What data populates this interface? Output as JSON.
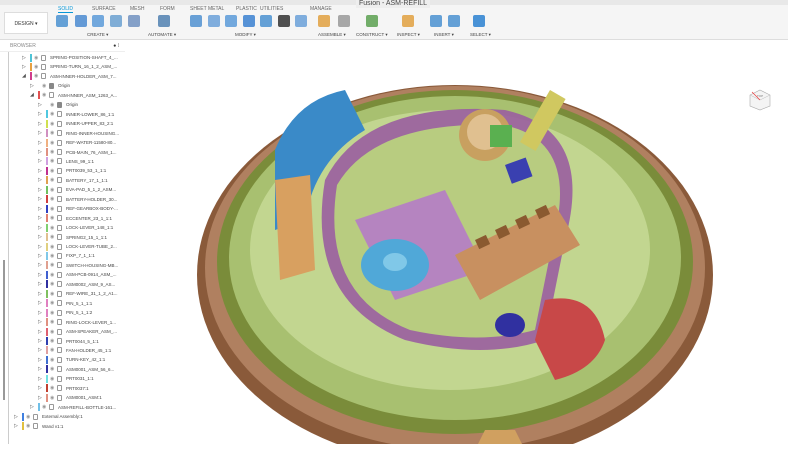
{
  "title": "Fusion - ASM-REFILL",
  "ribbon": {
    "design_label": "DESIGN ▾",
    "tabs": [
      "SOLID",
      "SURFACE",
      "MESH",
      "FORM",
      "SHEET METAL",
      "PLASTIC",
      "UTILITIES",
      "MANAGE"
    ],
    "active_tab": "SOLID",
    "groups": [
      "CREATE ▾",
      "AUTOMATE ▾",
      "MODIFY ▾",
      "ASSEMBLE ▾",
      "CONSTRUCT ▾",
      "INSPECT ▾",
      "INSERT ▾",
      "SELECT ▾"
    ]
  },
  "browser": {
    "title": "BROWSER",
    "items": [
      {
        "label": "SPRING-POSITION-SHAFT_4_...",
        "level": 1,
        "color": "#4ec3d6",
        "type": "body"
      },
      {
        "label": "SPRING-TURN_16_1_2_ASM_...",
        "level": 1,
        "color": "#e8a040",
        "type": "asm"
      },
      {
        "label": "ASM-INNER-HOLDER_ASM_7...",
        "level": 1,
        "color": "#d03c8c",
        "type": "asm",
        "expanded": true
      },
      {
        "label": "Origin",
        "level": 2,
        "color": "",
        "type": "folder"
      },
      {
        "label": "ASM-INNER_ASM_1263_A...",
        "level": 2,
        "color": "#e05050",
        "type": "asm",
        "expanded": true
      },
      {
        "label": "Origin",
        "level": 3,
        "color": "",
        "type": "folder"
      },
      {
        "label": "INNER-LOWER_86_1:1",
        "level": 3,
        "color": "#50c8e0",
        "type": "body"
      },
      {
        "label": "INNER-UPPER_83_2:1",
        "level": 3,
        "color": "#d0e050",
        "type": "body"
      },
      {
        "label": "RING-INNER-HOUSING...",
        "level": 3,
        "color": "#d090c0",
        "type": "body"
      },
      {
        "label": "REF-WATER-11580-80...",
        "level": 3,
        "color": "#f0b080",
        "type": "body"
      },
      {
        "label": "PCB-MAIN_76_ASM_1...",
        "level": 3,
        "color": "#e09080",
        "type": "asm"
      },
      {
        "label": "LENS_99_1:1",
        "level": 3,
        "color": "#d0a0e0",
        "type": "body"
      },
      {
        "label": "PRT0039_53_1_1:1",
        "level": 3,
        "color": "#c03090",
        "type": "body"
      },
      {
        "label": "BATTERY_17_1_1:1",
        "level": 3,
        "color": "#e0a050",
        "type": "body"
      },
      {
        "label": "EVA-PAD_5_1_2_ASM...",
        "level": 3,
        "color": "#70c060",
        "type": "asm"
      },
      {
        "label": "BATTERY-HOLDER_30...",
        "level": 3,
        "color": "#d04040",
        "type": "body"
      },
      {
        "label": "REF-GEARBOX-BODY-...",
        "level": 3,
        "color": "#3040c0",
        "type": "body"
      },
      {
        "label": "ECCENTER_23_1_1:1",
        "level": 3,
        "color": "#e08070",
        "type": "body"
      },
      {
        "label": "LOCK-LEVER_148_1:1",
        "level": 3,
        "color": "#80d070",
        "type": "body"
      },
      {
        "label": "SPRING2_15_1_1:1",
        "level": 3,
        "color": "#e0c090",
        "type": "body"
      },
      {
        "label": "LOCK-LEVER-TUBE_2...",
        "level": 3,
        "color": "#e0d080",
        "type": "body"
      },
      {
        "label": "FIXP_7_1_1:1",
        "level": 3,
        "color": "#80c8e8",
        "type": "body"
      },
      {
        "label": "SWITCH-HOUSING-MB...",
        "level": 3,
        "color": "#e0a090",
        "type": "body"
      },
      {
        "label": "ASM-PCB-0914_ASM_...",
        "level": 3,
        "color": "#4060d0",
        "type": "asm"
      },
      {
        "label": "ASM0002_ASM_9_AS...",
        "level": 3,
        "color": "#3030a0",
        "type": "asm"
      },
      {
        "label": "REF-WIRE_31_1_2_A1...",
        "level": 3,
        "color": "#80c060",
        "type": "asm"
      },
      {
        "label": "PIN_5_1_1:1",
        "level": 3,
        "color": "#e080c0",
        "type": "body"
      },
      {
        "label": "PIN_5_1_1:2",
        "level": 3,
        "color": "#e080c0",
        "type": "body"
      },
      {
        "label": "RING-LOCK-LEVER_1...",
        "level": 3,
        "color": "#e09080",
        "type": "body"
      },
      {
        "label": "ASM-SPEAKER_ASM_...",
        "level": 3,
        "color": "#e06070",
        "type": "asm"
      },
      {
        "label": "PRT0044_5_1:1",
        "level": 3,
        "color": "#3040b0",
        "type": "body"
      },
      {
        "label": "FAN-HOLDER_45_1:1",
        "level": 3,
        "color": "#e0a0a0",
        "type": "body"
      },
      {
        "label": "TURN-KEY_42_1:1",
        "level": 3,
        "color": "#4070d0",
        "type": "body"
      },
      {
        "label": "ASM0001_ASM_56_6...",
        "level": 3,
        "color": "#3030a0",
        "type": "asm"
      },
      {
        "label": "PRT0031_1:1",
        "level": 3,
        "color": "#70e0e0",
        "type": "body"
      },
      {
        "label": "PRT0037:1",
        "level": 3,
        "color": "#c04030",
        "type": "body"
      },
      {
        "label": "ASM0001_ASM:1",
        "level": 3,
        "color": "#e09080",
        "type": "asm"
      },
      {
        "label": "ASM-REFILL-BOTTLE-161...",
        "level": 2,
        "color": "#70c0e8",
        "type": "asm"
      },
      {
        "label": "External Assembly:1",
        "level": 0,
        "color": "#4080e0",
        "type": "asm"
      },
      {
        "label": "Wand v1:1",
        "level": 0,
        "color": "#e0c040",
        "type": "asm"
      }
    ]
  },
  "viewcube": {
    "face": "TOP"
  }
}
